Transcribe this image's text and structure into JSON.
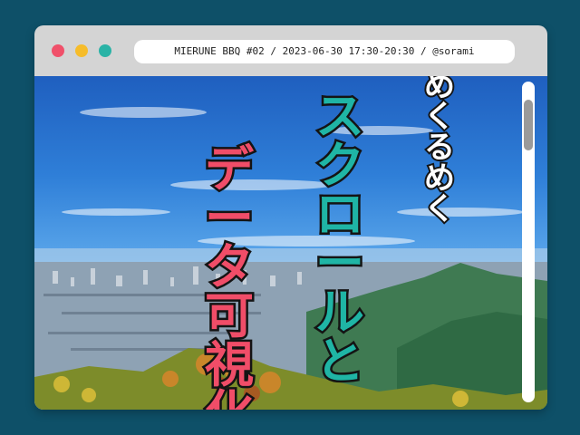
{
  "window": {
    "controls": [
      {
        "name": "close",
        "color": "#f0506a"
      },
      {
        "name": "minimize",
        "color": "#f6bc2a"
      },
      {
        "name": "maximize",
        "color": "#2ab3a6"
      }
    ],
    "address": "MIERUNE BBQ #02  /  2023-06-30 17:30-20:30  /  @sorami"
  },
  "content": {
    "line1": [
      "め",
      "く",
      "る",
      "め",
      "く"
    ],
    "line2": [
      "ス",
      "ク",
      "ロ",
      "ー",
      "ル",
      "と"
    ],
    "line3": [
      "デ",
      "ー",
      "タ",
      "可",
      "視",
      "化"
    ],
    "colors": {
      "line1": "#ffffff",
      "line2": "#1fb5a5",
      "line3": "#f04d68",
      "outline": "#141414"
    },
    "background": "aerial photo of a city with autumn mountains under a blue sky"
  },
  "scrollbar": {
    "position_fraction": 0.0
  }
}
